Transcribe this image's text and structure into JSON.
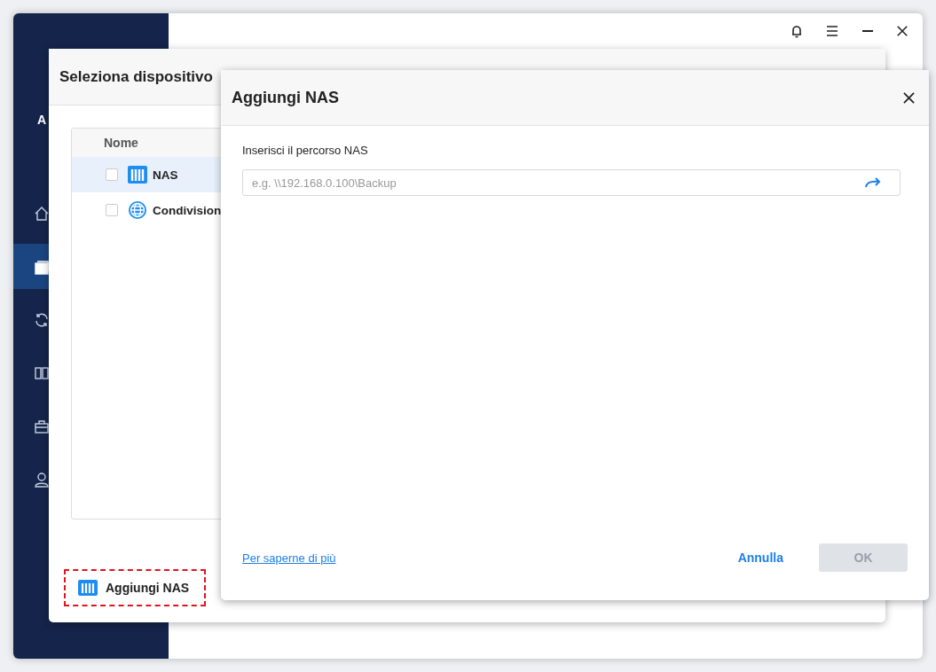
{
  "app": {
    "logo_text": "A",
    "nav": [
      {
        "kind": "home",
        "selected": false
      },
      {
        "kind": "backup",
        "selected": true
      },
      {
        "kind": "sync",
        "selected": false
      },
      {
        "kind": "clone",
        "selected": false
      },
      {
        "kind": "tools",
        "selected": false
      },
      {
        "kind": "user",
        "selected": false
      }
    ]
  },
  "select_dialog": {
    "title": "Seleziona dispositivo",
    "table": {
      "columns": [
        "Nome"
      ],
      "rows": [
        {
          "name": "NAS",
          "kind": "nas",
          "checked": false,
          "selected": true
        },
        {
          "name": "Condivision",
          "kind": "share",
          "checked": false,
          "selected": false
        }
      ]
    },
    "add_button": "Aggiungi NAS"
  },
  "nas_dialog": {
    "title": "Aggiungi NAS",
    "field_label": "Inserisci il percorso NAS",
    "path_field": {
      "placeholder": "e.g. \\\\192.168.0.100\\Backup"
    },
    "help_link": "Per saperne di più",
    "buttons": [
      {
        "label": "Annulla",
        "kind": "link",
        "disabled": false
      },
      {
        "label": "OK",
        "kind": "primary",
        "disabled": true
      }
    ]
  }
}
